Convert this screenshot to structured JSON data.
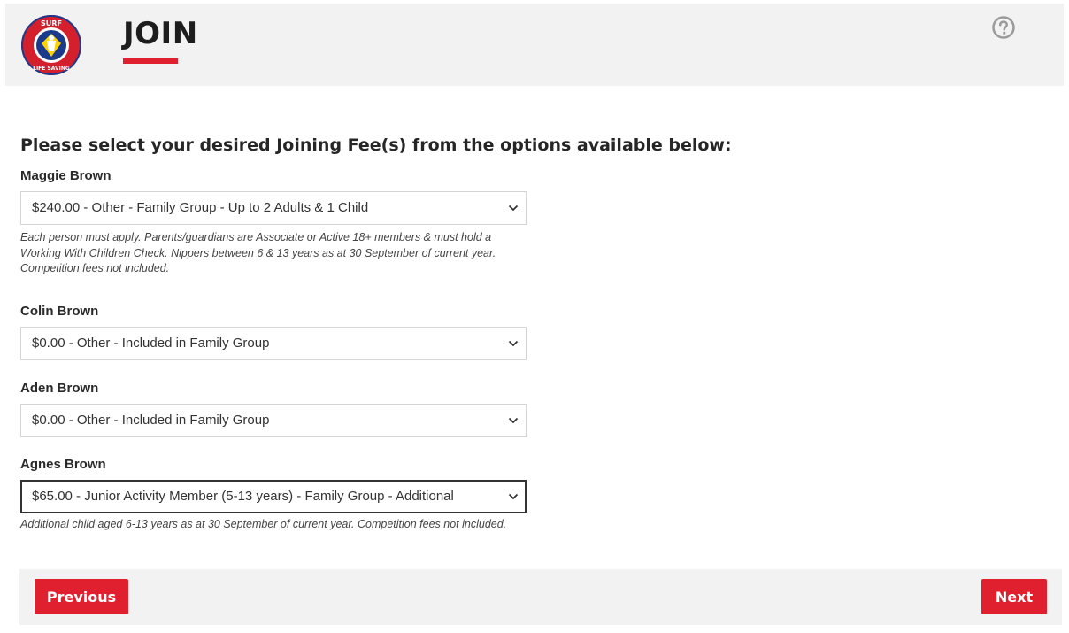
{
  "header": {
    "logo_alt": "Surf Life Saving",
    "logo_text_top": "SURF",
    "logo_text_bottom": "LIFE SAVING",
    "title": "JOIN",
    "help_icon": "question-circle-icon"
  },
  "form": {
    "heading": "Please select your desired Joining Fee(s) from the options available below:",
    "members": [
      {
        "name": "Maggie Brown",
        "selected": "$240.00 - Other - Family Group - Up to 2 Adults & 1 Child",
        "help": "Each person must apply. Parents/guardians are Associate or Active 18+ members & must hold a Working With Children Check. Nippers between 6 & 13 years as at 30 September of current year. Competition fees not included."
      },
      {
        "name": "Colin Brown",
        "selected": "$0.00 - Other - Included in Family Group"
      },
      {
        "name": "Aden Brown",
        "selected": "$0.00 - Other - Included in Family Group"
      },
      {
        "name": "Agnes Brown",
        "selected": "$65.00 - Junior Activity Member (5-13 years) - Family Group - Additional",
        "help": "Additional child aged 6-13 years as at 30 September of current year. Competition fees not included."
      }
    ]
  },
  "footer": {
    "previous_label": "Previous",
    "next_label": "Next"
  },
  "colors": {
    "accent": "#e0202f",
    "header_bg": "#f2f2f2"
  }
}
